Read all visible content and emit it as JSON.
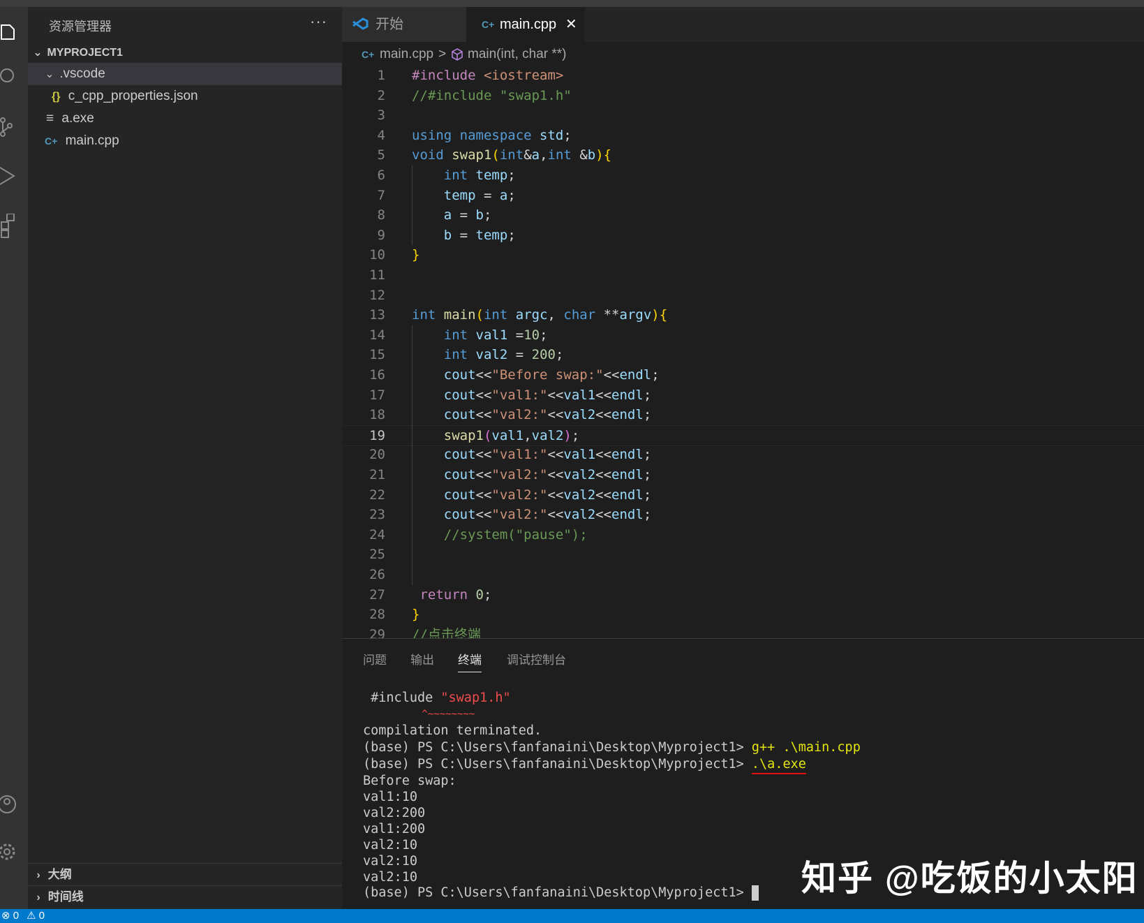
{
  "sidebar": {
    "title": "资源管理器",
    "more": "···",
    "project": "MYPROJECT1",
    "tree": [
      {
        "label": ".vscode",
        "type": "folder",
        "expanded": true
      },
      {
        "label": "c_cpp_properties.json",
        "type": "json",
        "icon": "{}"
      },
      {
        "label": "a.exe",
        "type": "exe",
        "icon": "≡"
      },
      {
        "label": "main.cpp",
        "type": "cpp",
        "icon": "C+"
      }
    ],
    "outline": "大纲",
    "timeline": "时间线"
  },
  "tabs": [
    {
      "label": "开始",
      "active": false
    },
    {
      "label": "main.cpp",
      "active": true,
      "close": "✕"
    }
  ],
  "breadcrumb": {
    "file": "main.cpp",
    "sep": ">",
    "symbol": "main(int, char **)"
  },
  "editor": {
    "active_line": 19,
    "lines": [
      [
        [
          "#include ",
          "ctl"
        ],
        [
          "<iostream>",
          "str"
        ]
      ],
      [
        [
          "//#include \"swap1.h\"",
          "cmt"
        ]
      ],
      [],
      [
        [
          "using ",
          "kw"
        ],
        [
          "namespace ",
          "kw"
        ],
        [
          "std",
          "var"
        ],
        [
          ";",
          ""
        ]
      ],
      [
        [
          "void ",
          "kw"
        ],
        [
          "swap1",
          "fn"
        ],
        [
          "(",
          "br"
        ],
        [
          "int",
          "kw"
        ],
        [
          "&",
          ""
        ],
        [
          "a",
          "var"
        ],
        [
          ",",
          ""
        ],
        [
          "int ",
          "kw"
        ],
        [
          "&",
          ""
        ],
        [
          "b",
          "var"
        ],
        [
          ")",
          "br"
        ],
        [
          "{",
          "br"
        ]
      ],
      [
        [
          "    ",
          ""
        ],
        [
          "int ",
          "kw"
        ],
        [
          "temp",
          "var"
        ],
        [
          ";",
          ""
        ]
      ],
      [
        [
          "    ",
          ""
        ],
        [
          "temp",
          "var"
        ],
        [
          " = ",
          ""
        ],
        [
          "a",
          "var"
        ],
        [
          ";",
          ""
        ]
      ],
      [
        [
          "    ",
          ""
        ],
        [
          "a",
          "var"
        ],
        [
          " = ",
          ""
        ],
        [
          "b",
          "var"
        ],
        [
          ";",
          ""
        ]
      ],
      [
        [
          "    ",
          ""
        ],
        [
          "b",
          "var"
        ],
        [
          " = ",
          ""
        ],
        [
          "temp",
          "var"
        ],
        [
          ";",
          ""
        ]
      ],
      [
        [
          "}",
          "br"
        ]
      ],
      [],
      [],
      [
        [
          "int ",
          "kw"
        ],
        [
          "main",
          "fn"
        ],
        [
          "(",
          "br"
        ],
        [
          "int ",
          "kw"
        ],
        [
          "argc",
          "var"
        ],
        [
          ", ",
          ""
        ],
        [
          "char ",
          "kw"
        ],
        [
          "**",
          ""
        ],
        [
          "argv",
          "var"
        ],
        [
          ")",
          "br"
        ],
        [
          "{",
          "br"
        ]
      ],
      [
        [
          "    ",
          ""
        ],
        [
          "int ",
          "kw"
        ],
        [
          "val1",
          "var"
        ],
        [
          " =",
          ""
        ],
        [
          "10",
          "num"
        ],
        [
          ";",
          ""
        ]
      ],
      [
        [
          "    ",
          ""
        ],
        [
          "int ",
          "kw"
        ],
        [
          "val2",
          "var"
        ],
        [
          " = ",
          ""
        ],
        [
          "200",
          "num"
        ],
        [
          ";",
          ""
        ]
      ],
      [
        [
          "    ",
          ""
        ],
        [
          "cout",
          "var"
        ],
        [
          "<<",
          ""
        ],
        [
          "\"Before swap:\"",
          "str"
        ],
        [
          "<<",
          ""
        ],
        [
          "endl",
          "var"
        ],
        [
          ";",
          ""
        ]
      ],
      [
        [
          "    ",
          ""
        ],
        [
          "cout",
          "var"
        ],
        [
          "<<",
          ""
        ],
        [
          "\"val1:\"",
          "str"
        ],
        [
          "<<",
          ""
        ],
        [
          "val1",
          "var"
        ],
        [
          "<<",
          ""
        ],
        [
          "endl",
          "var"
        ],
        [
          ";",
          ""
        ]
      ],
      [
        [
          "    ",
          ""
        ],
        [
          "cout",
          "var"
        ],
        [
          "<<",
          ""
        ],
        [
          "\"val2:\"",
          "str"
        ],
        [
          "<<",
          ""
        ],
        [
          "val2",
          "var"
        ],
        [
          "<<",
          ""
        ],
        [
          "endl",
          "var"
        ],
        [
          ";",
          ""
        ]
      ],
      [
        [
          "    ",
          ""
        ],
        [
          "swap1",
          "fn"
        ],
        [
          "(",
          "br2"
        ],
        [
          "val1",
          "var"
        ],
        [
          ",",
          ""
        ],
        [
          "val2",
          "var"
        ],
        [
          ")",
          "br2"
        ],
        [
          ";",
          ""
        ]
      ],
      [
        [
          "    ",
          ""
        ],
        [
          "cout",
          "var"
        ],
        [
          "<<",
          ""
        ],
        [
          "\"val1:\"",
          "str"
        ],
        [
          "<<",
          ""
        ],
        [
          "val1",
          "var"
        ],
        [
          "<<",
          ""
        ],
        [
          "endl",
          "var"
        ],
        [
          ";",
          ""
        ]
      ],
      [
        [
          "    ",
          ""
        ],
        [
          "cout",
          "var"
        ],
        [
          "<<",
          ""
        ],
        [
          "\"val2:\"",
          "str"
        ],
        [
          "<<",
          ""
        ],
        [
          "val2",
          "var"
        ],
        [
          "<<",
          ""
        ],
        [
          "endl",
          "var"
        ],
        [
          ";",
          ""
        ]
      ],
      [
        [
          "    ",
          ""
        ],
        [
          "cout",
          "var"
        ],
        [
          "<<",
          ""
        ],
        [
          "\"val2:\"",
          "str"
        ],
        [
          "<<",
          ""
        ],
        [
          "val2",
          "var"
        ],
        [
          "<<",
          ""
        ],
        [
          "endl",
          "var"
        ],
        [
          ";",
          ""
        ]
      ],
      [
        [
          "    ",
          ""
        ],
        [
          "cout",
          "var"
        ],
        [
          "<<",
          ""
        ],
        [
          "\"val2:\"",
          "str"
        ],
        [
          "<<",
          ""
        ],
        [
          "val2",
          "var"
        ],
        [
          "<<",
          ""
        ],
        [
          "endl",
          "var"
        ],
        [
          ";",
          ""
        ]
      ],
      [
        [
          "    ",
          ""
        ],
        [
          "//system(\"pause\");",
          "cmt"
        ]
      ],
      [],
      [],
      [
        [
          " ",
          ""
        ],
        [
          "return ",
          "ctl"
        ],
        [
          "0",
          "num"
        ],
        [
          ";",
          ""
        ]
      ],
      [
        [
          "}",
          "br"
        ]
      ],
      [
        [
          "//点击终端",
          "cmt"
        ]
      ]
    ]
  },
  "panel": {
    "tabs": [
      "问题",
      "输出",
      "终端",
      "调试控制台"
    ],
    "active_tab": "终端",
    "terminal": {
      "include_prefix": " #include ",
      "include_file": "\"swap1.h\"",
      "squiggle": "          ^~~~~~~~~",
      "lines_a": [
        "compilation terminated."
      ],
      "prompt": "(base) PS C:\\Users\\fanfanaini\\Desktop\\Myproject1> ",
      "cmd1": "g++ .\\main.cpp",
      "cmd2": ".\\a.exe",
      "output": [
        "Before swap:",
        "val1:10",
        "val2:200",
        "val1:200",
        "val2:10",
        "val2:10",
        "val2:10"
      ]
    }
  },
  "watermark": "知乎 @吃饭的小太阳",
  "statusbar": {
    "errors": "⊗ 0",
    "warnings": "⚠ 0"
  },
  "colors": {
    "accent": "#007acc",
    "editor_bg": "#1e1e1e",
    "sidebar_bg": "#252526"
  }
}
